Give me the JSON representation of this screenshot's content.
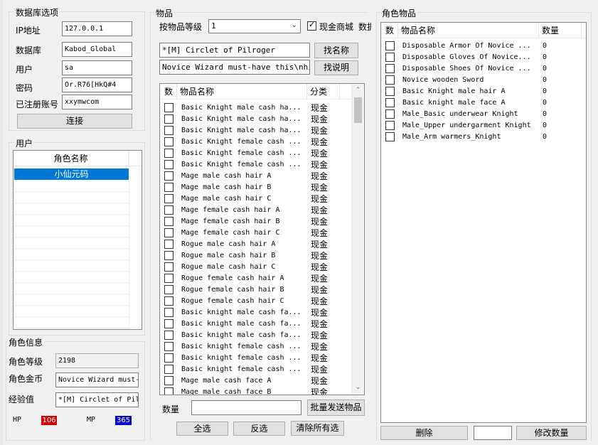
{
  "db": {
    "title": "数据库选项",
    "ip_label": "IP地址",
    "ip_value": "127.0.0.1",
    "db_label": "数据库",
    "db_value": "Kabod_Global",
    "user_label": "用户",
    "user_value": "sa",
    "pwd_label": "密码",
    "pwd_value": "Or.R76[HkQ#4",
    "acct_label": "已注册账号",
    "acct_value": "xxymwcom",
    "connect_label": "连接"
  },
  "users": {
    "title": "用户",
    "column": "角色名称",
    "rows": [
      "小仙元码"
    ]
  },
  "char_info": {
    "title": "角色信息",
    "level_label": "角色等级",
    "level_value": "2198",
    "gold_label": "角色金币",
    "gold_value": "Novice Wizard must-have this\\nhigh",
    "exp_label": "经验值",
    "exp_value": "*[M] Circlet of Pilroger",
    "hp_label": "HP",
    "hp_value": "106",
    "mp_label": "MP",
    "mp_value": "365",
    "hp_color": "#cc0000",
    "mp_color": "#0000cc"
  },
  "items": {
    "title": "物品",
    "level_filter_label": "按物品等级",
    "level_filter_value": "1",
    "cash_label": "现金商城",
    "cash_checked": true,
    "data_label": "数据",
    "name_search_value": "*[M] Circlet of Pilroger",
    "desc_search_value": "Novice Wizard must-have this\\nhigh",
    "find_name_label": "找名称",
    "find_desc_label": "找说明",
    "columns": [
      "数",
      "物品名称",
      "分类"
    ],
    "rows": [
      {
        "name": "Basic Knight male cash ha...",
        "category": "现金"
      },
      {
        "name": "Basic Knight male cash ha...",
        "category": "现金"
      },
      {
        "name": "Basic Knight male cash ha...",
        "category": "现金"
      },
      {
        "name": "Basic Knight female cash ...",
        "category": "现金"
      },
      {
        "name": "Basic Knight female cash ...",
        "category": "现金"
      },
      {
        "name": "Basic Knight female cash ...",
        "category": "现金"
      },
      {
        "name": "Mage male cash hair A",
        "category": "现金"
      },
      {
        "name": "Mage male cash hair B",
        "category": "现金"
      },
      {
        "name": "Mage male cash hair C",
        "category": "现金"
      },
      {
        "name": "Mage female cash hair A",
        "category": "现金"
      },
      {
        "name": "Mage female cash hair B",
        "category": "现金"
      },
      {
        "name": "Mage female cash hair C",
        "category": "现金"
      },
      {
        "name": "Rogue male cash hair A",
        "category": "现金"
      },
      {
        "name": "Rogue male cash hair B",
        "category": "现金"
      },
      {
        "name": "Rogue male cash hair C",
        "category": "现金"
      },
      {
        "name": "Rogue female cash hair A",
        "category": "现金"
      },
      {
        "name": "Rogue female cash hair B",
        "category": "现金"
      },
      {
        "name": "Rogue female cash hair C",
        "category": "现金"
      },
      {
        "name": "Basic knight male cash fa...",
        "category": "现金"
      },
      {
        "name": "Basic knight male cash fa...",
        "category": "现金"
      },
      {
        "name": "Basic knight male cash fa...",
        "category": "现金"
      },
      {
        "name": "Basic knight female cash ...",
        "category": "现金"
      },
      {
        "name": "Basic knight female cash ...",
        "category": "现金"
      },
      {
        "name": "Basic knight female cash ...",
        "category": "现金"
      },
      {
        "name": "Mage male cash face A",
        "category": "现金"
      },
      {
        "name": "Mage male cash face B",
        "category": "现金"
      }
    ],
    "qty_label": "数量",
    "qty_value": "",
    "bulk_send_label": "批量发送物品",
    "select_all_label": "全选",
    "invert_label": "反选",
    "clear_all_label": "清除所有选"
  },
  "char_items": {
    "title": "角色物品",
    "columns": [
      "数",
      "物品名称",
      "数量"
    ],
    "rows": [
      {
        "name": "Disposable Armor Of Novice ...",
        "qty": "0"
      },
      {
        "name": "Disposable Gloves Of Novice...",
        "qty": "0"
      },
      {
        "name": "Disposable Shoes Of Novice ...",
        "qty": "0"
      },
      {
        "name": "Novice wooden Sword",
        "qty": "0"
      },
      {
        "name": "Basic Knight male hair A",
        "qty": "0"
      },
      {
        "name": "Basic knight male face A",
        "qty": "0"
      },
      {
        "name": "Male_Basic underwear Knight",
        "qty": "0"
      },
      {
        "name": "Male_Upper undergarment Knight",
        "qty": "0"
      },
      {
        "name": "Male_Arm warmers_Knight",
        "qty": "0"
      }
    ],
    "delete_label": "删除",
    "qty_edit_value": "",
    "modify_qty_label": "修改数量"
  }
}
